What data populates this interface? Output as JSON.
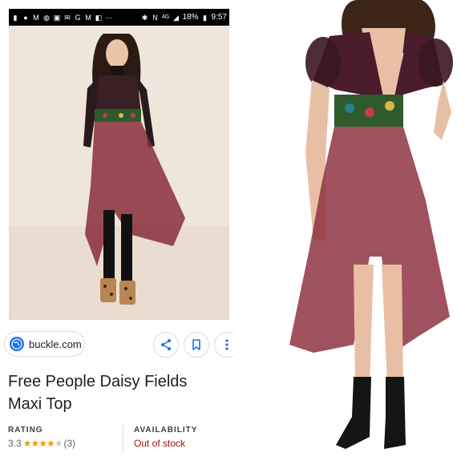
{
  "status_bar": {
    "battery": "18%",
    "time": "9:57"
  },
  "result": {
    "source": "buckle.com",
    "title": "Free People Daisy Fields Maxi Top",
    "rating_label": "RATING",
    "rating_value": "3.3",
    "rating_count": "(3)",
    "rating_stars": 3.3,
    "availability_label": "AVAILABILITY",
    "availability_value": "Out of stock"
  },
  "icons": {
    "share": "share-icon",
    "save": "bookmark-icon",
    "more": "more-vert-icon",
    "globe": "globe-icon"
  },
  "colors": {
    "availability": "#a50e0e",
    "stars": "#f29900",
    "accent": "#1a73e8"
  }
}
